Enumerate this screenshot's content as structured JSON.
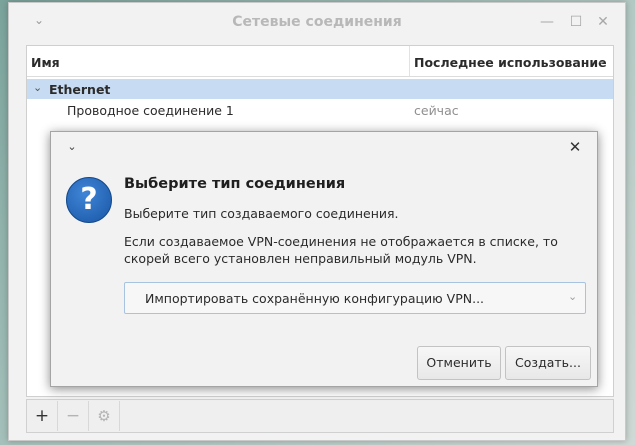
{
  "window": {
    "title": "Сетевые соединения",
    "menu_glyph": "⌄",
    "minimize_glyph": "—",
    "maximize_glyph": "☐",
    "close_glyph": "✕"
  },
  "list": {
    "columns": {
      "name": "Имя",
      "last_used": "Последнее использование",
      "sort_glyph": "⌄"
    },
    "group": {
      "label": "Ethernet",
      "expander_glyph": "⌄"
    },
    "connections": [
      {
        "name": "Проводное соединение 1",
        "last_used": "сейчас"
      }
    ]
  },
  "toolbar": {
    "add": "+",
    "remove": "−",
    "settings": "⚙"
  },
  "dialog": {
    "menu_glyph": "⌄",
    "close_glyph": "✕",
    "icon_glyph": "?",
    "title": "Выберите тип соединения",
    "subtitle": "Выберите тип создаваемого соединения.",
    "description": "Если создаваемое VPN-соединения не отображается в списке, то скорей всего установлен неправильный модуль VPN.",
    "connection_type": {
      "value": "Импортировать сохранённую конфигурацию VPN...",
      "arrow_glyph": "⌄"
    },
    "cancel_label": "Отменить",
    "create_label": "Создать..."
  }
}
